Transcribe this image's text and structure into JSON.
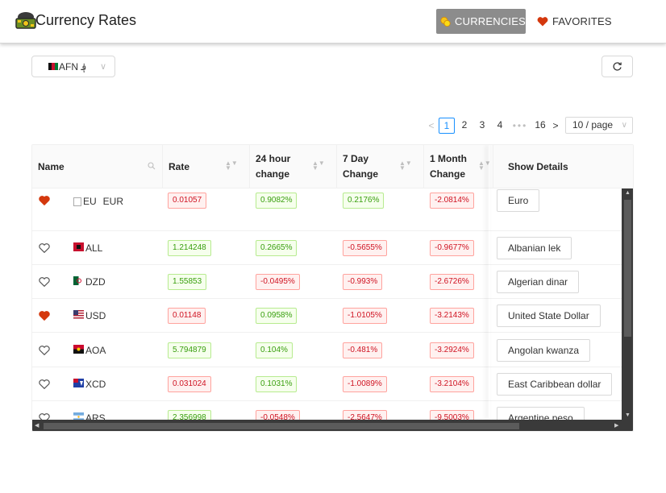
{
  "header": {
    "title": "Currency Rates",
    "nav": {
      "currencies": "CURRENCIES",
      "favorites": "FAVORITES"
    }
  },
  "toolbar": {
    "base_currency": "AFN ؋",
    "base_icon": "afghanistan-flag"
  },
  "pagination": {
    "pages": [
      "1",
      "2",
      "3",
      "4"
    ],
    "ellipsis": "•••",
    "last_page": "16",
    "page_size": "10 / page",
    "current": "1"
  },
  "table": {
    "columns": {
      "name": "Name",
      "rate": "Rate",
      "change_24h": "24 hour change",
      "change_7d": "7 Day Change",
      "change_1m": "1 Month Change",
      "details": "Show Details"
    },
    "rows": [
      {
        "favorite": true,
        "flag_alt": "EU",
        "code": "EUR",
        "rate": "0.01057",
        "rate_up": false,
        "h24": "0.9082%",
        "h24_up": true,
        "d7": "0.2176%",
        "d7_up": true,
        "m1": "-2.0814%",
        "m1_up": false,
        "details": "Euro"
      },
      {
        "favorite": false,
        "code": "ALL",
        "rate": "1.214248",
        "rate_up": true,
        "h24": "0.2665%",
        "h24_up": true,
        "d7": "-0.5655%",
        "d7_up": false,
        "m1": "-0.9677%",
        "m1_up": false,
        "details": "Albanian lek"
      },
      {
        "favorite": false,
        "code": "DZD",
        "rate": "1.55853",
        "rate_up": true,
        "h24": "-0.0495%",
        "h24_up": false,
        "d7": "-0.993%",
        "d7_up": false,
        "m1": "-2.6726%",
        "m1_up": false,
        "details": "Algerian dinar"
      },
      {
        "favorite": true,
        "code": "USD",
        "rate": "0.01148",
        "rate_up": false,
        "h24": "0.0958%",
        "h24_up": true,
        "d7": "-1.0105%",
        "d7_up": false,
        "m1": "-3.2143%",
        "m1_up": false,
        "details": "United State Dollar"
      },
      {
        "favorite": false,
        "code": "AOA",
        "rate": "5.794879",
        "rate_up": true,
        "h24": "0.104%",
        "h24_up": true,
        "d7": "-0.481%",
        "d7_up": false,
        "m1": "-3.2924%",
        "m1_up": false,
        "details": "Angolan kwanza"
      },
      {
        "favorite": false,
        "code": "XCD",
        "rate": "0.031024",
        "rate_up": false,
        "h24": "0.1031%",
        "h24_up": true,
        "d7": "-1.0089%",
        "d7_up": false,
        "m1": "-3.2104%",
        "m1_up": false,
        "details": "East Caribbean dollar"
      },
      {
        "favorite": false,
        "code": "ARS",
        "rate": "2.356998",
        "rate_up": true,
        "h24": "-0.0548%",
        "h24_up": false,
        "d7": "-2.5647%",
        "d7_up": false,
        "m1": "-9.5003%",
        "m1_up": false,
        "details": "Argentine peso"
      }
    ]
  },
  "colors": {
    "favorite_heart": "#d4380d",
    "active_nav_bg": "#8c8c8c",
    "pagination_active": "#1890ff",
    "positive": "#389e0d",
    "negative": "#cf1322"
  }
}
